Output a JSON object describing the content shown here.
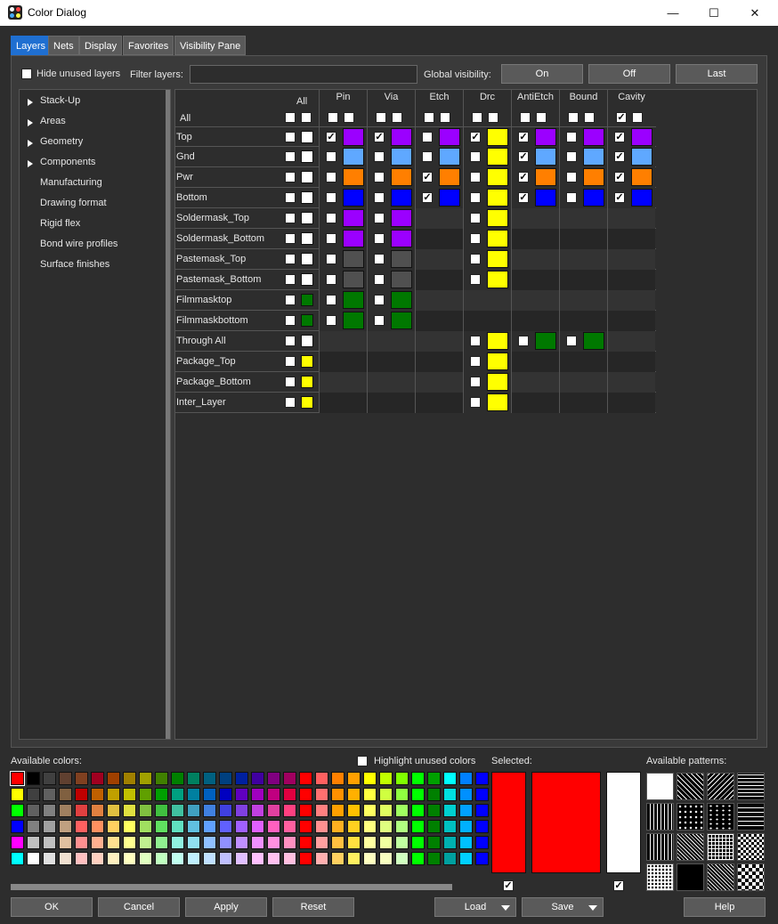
{
  "window": {
    "title": "Color Dialog",
    "minimize": "—",
    "maximize": "☐",
    "close": "✕"
  },
  "tabs": [
    "Layers",
    "Nets",
    "Display",
    "Favorites",
    "Visibility Pane"
  ],
  "toolbar": {
    "hide_unused": "Hide unused layers",
    "filter_label": "Filter layers:",
    "filter_value": "",
    "global_label": "Global visibility:",
    "on": "On",
    "off": "Off",
    "last": "Last"
  },
  "tree": [
    {
      "label": "Stack-Up",
      "expandable": true
    },
    {
      "label": "Areas",
      "expandable": true
    },
    {
      "label": "Geometry",
      "expandable": true
    },
    {
      "label": "Components",
      "expandable": true
    },
    {
      "label": "Manufacturing",
      "expandable": false
    },
    {
      "label": "Drawing format",
      "expandable": false
    },
    {
      "label": "Rigid flex",
      "expandable": false
    },
    {
      "label": "Bond wire profiles",
      "expandable": false
    },
    {
      "label": "Surface finishes",
      "expandable": false
    }
  ],
  "columns": {
    "all": "All",
    "groups": [
      "Pin",
      "Via",
      "Etch",
      "Drc",
      "AntiEtch",
      "Bound",
      "Cavity"
    ]
  },
  "all_row": {
    "label": "All",
    "checks": [
      false,
      false,
      false,
      false,
      false,
      false,
      true
    ]
  },
  "rows": [
    {
      "label": "Top",
      "all_color": "#ffffff",
      "cells": [
        {
          "c": true,
          "color": "#9b00ff"
        },
        {
          "c": true,
          "color": "#9b00ff"
        },
        {
          "c": false,
          "color": "#9b00ff"
        },
        {
          "c": true,
          "color": "#ffff00"
        },
        {
          "c": true,
          "color": "#9b00ff"
        },
        {
          "c": false,
          "color": "#9b00ff"
        },
        {
          "c": true,
          "color": "#9b00ff"
        }
      ]
    },
    {
      "label": "Gnd",
      "all_color": "#ffffff",
      "cells": [
        {
          "c": false,
          "color": "#5fa8ff"
        },
        {
          "c": false,
          "color": "#5fa8ff"
        },
        {
          "c": false,
          "color": "#5fa8ff"
        },
        {
          "c": false,
          "color": "#ffff00"
        },
        {
          "c": true,
          "color": "#5fa8ff"
        },
        {
          "c": false,
          "color": "#5fa8ff"
        },
        {
          "c": true,
          "color": "#5fa8ff"
        }
      ]
    },
    {
      "label": "Pwr",
      "all_color": "#ffffff",
      "cells": [
        {
          "c": false,
          "color": "#ff7f00"
        },
        {
          "c": false,
          "color": "#ff7f00"
        },
        {
          "c": true,
          "color": "#ff7f00"
        },
        {
          "c": false,
          "color": "#ffff00"
        },
        {
          "c": true,
          "color": "#ff7f00"
        },
        {
          "c": false,
          "color": "#ff7f00"
        },
        {
          "c": true,
          "color": "#ff7f00"
        }
      ]
    },
    {
      "label": "Bottom",
      "all_color": "#ffffff",
      "cells": [
        {
          "c": false,
          "color": "#0000ff"
        },
        {
          "c": false,
          "color": "#0000ff"
        },
        {
          "c": true,
          "color": "#0000ff"
        },
        {
          "c": false,
          "color": "#ffff00"
        },
        {
          "c": true,
          "color": "#0000ff"
        },
        {
          "c": false,
          "color": "#0000ff"
        },
        {
          "c": true,
          "color": "#0000ff"
        }
      ]
    },
    {
      "label": "Soldermask_Top",
      "all_color": "#ffffff",
      "cells": [
        {
          "c": false,
          "color": "#9b00ff"
        },
        {
          "c": false,
          "color": "#9b00ff"
        },
        null,
        {
          "c": false,
          "color": "#ffff00"
        },
        null,
        null,
        null
      ]
    },
    {
      "label": "Soldermask_Bottom",
      "all_color": "#ffffff",
      "cells": [
        {
          "c": false,
          "color": "#9b00ff"
        },
        {
          "c": false,
          "color": "#9b00ff"
        },
        null,
        {
          "c": false,
          "color": "#ffff00"
        },
        null,
        null,
        null
      ]
    },
    {
      "label": "Pastemask_Top",
      "all_color": "#ffffff",
      "cells": [
        {
          "c": false,
          "color": "#505050"
        },
        {
          "c": false,
          "color": "#505050"
        },
        null,
        {
          "c": false,
          "color": "#ffff00"
        },
        null,
        null,
        null
      ]
    },
    {
      "label": "Pastemask_Bottom",
      "all_color": "#ffffff",
      "cells": [
        {
          "c": false,
          "color": "#505050"
        },
        {
          "c": false,
          "color": "#505050"
        },
        null,
        {
          "c": false,
          "color": "#ffff00"
        },
        null,
        null,
        null
      ]
    },
    {
      "label": "Filmmasktop",
      "all_color": "#007800",
      "cells": [
        {
          "c": false,
          "color": "#007800"
        },
        {
          "c": false,
          "color": "#007800"
        },
        null,
        null,
        null,
        null,
        null
      ]
    },
    {
      "label": "Filmmaskbottom",
      "all_color": "#007800",
      "cells": [
        {
          "c": false,
          "color": "#007800"
        },
        {
          "c": false,
          "color": "#007800"
        },
        null,
        null,
        null,
        null,
        null
      ]
    },
    {
      "label": "Through All",
      "all_color": "#ffffff",
      "cells": [
        null,
        null,
        null,
        {
          "c": false,
          "color": "#ffff00"
        },
        {
          "c": false,
          "color": "#007800"
        },
        {
          "c": false,
          "color": "#007800"
        },
        null
      ]
    },
    {
      "label": "Package_Top",
      "all_color": "#ffff00",
      "cells": [
        null,
        null,
        null,
        {
          "c": false,
          "color": "#ffff00"
        },
        null,
        null,
        null
      ]
    },
    {
      "label": "Package_Bottom",
      "all_color": "#ffff00",
      "cells": [
        null,
        null,
        null,
        {
          "c": false,
          "color": "#ffff00"
        },
        null,
        null,
        null
      ]
    },
    {
      "label": "Inter_Layer",
      "all_color": "#ffff00",
      "cells": [
        null,
        null,
        null,
        {
          "c": false,
          "color": "#ffff00"
        },
        null,
        null,
        null
      ]
    }
  ],
  "bottom": {
    "available_colors": "Available colors:",
    "highlight_unused": "Highlight unused colors",
    "selected": "Selected:",
    "available_patterns": "Available patterns:",
    "selected_color": "#ff0000",
    "selected_pattern": "#ffffff"
  },
  "buttons": {
    "ok": "OK",
    "cancel": "Cancel",
    "apply": "Apply",
    "reset": "Reset",
    "load": "Load",
    "save": "Save",
    "help": "Help"
  }
}
